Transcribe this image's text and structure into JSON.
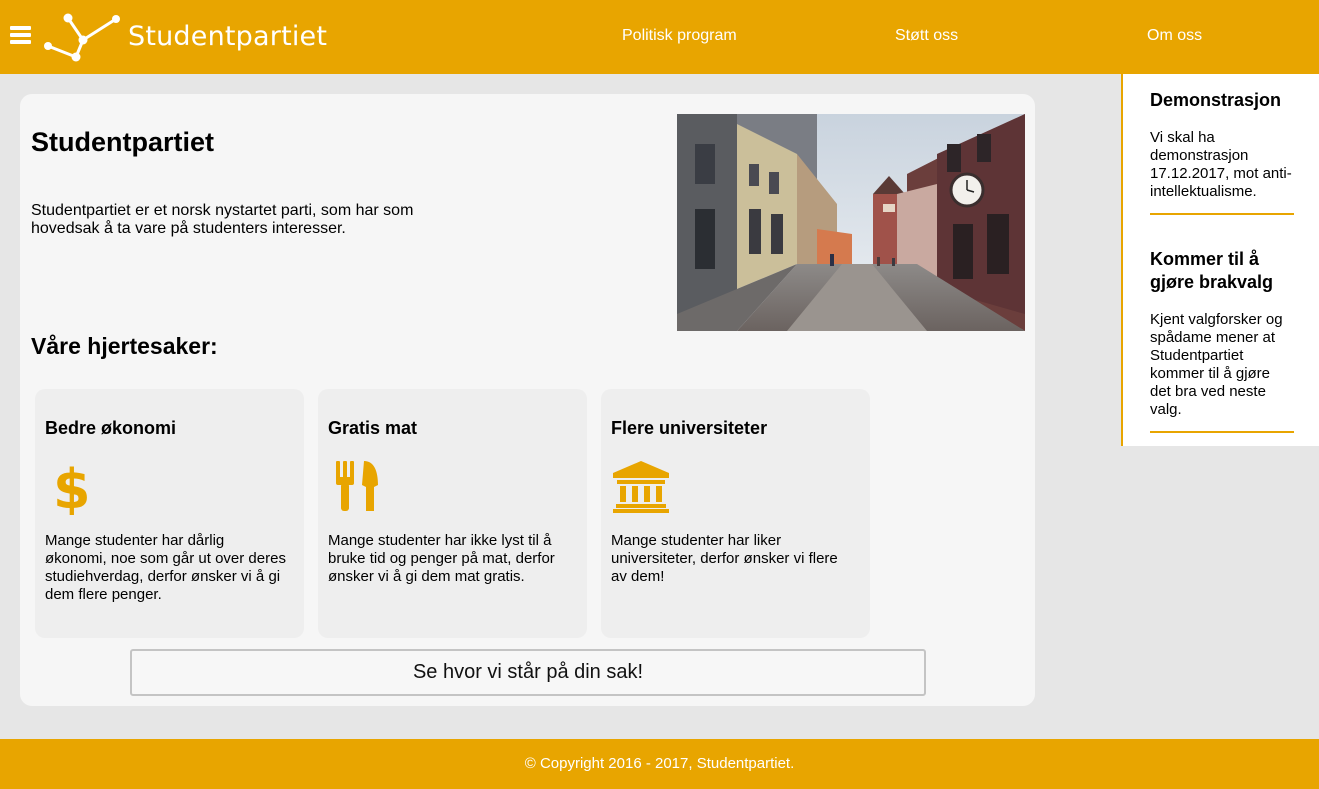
{
  "header": {
    "brand": "Studentpartiet",
    "nav": [
      {
        "label": "Politisk program"
      },
      {
        "label": "Støtt oss"
      },
      {
        "label": "Om oss"
      }
    ]
  },
  "main": {
    "title": "Studentpartiet",
    "intro": "Studentpartiet er et norsk nystartet parti, som har som hovedsak å ta vare på studenters interesser.",
    "section_title": "Våre hjertesaker:",
    "cards": [
      {
        "title": "Bedre økonomi",
        "icon": "dollar-icon",
        "text": "Mange studenter har dårlig økonomi, noe som går ut over deres studiehverdag, derfor ønsker vi å gi dem flere penger."
      },
      {
        "title": "Gratis mat",
        "icon": "cutlery-icon",
        "text": "Mange studenter har ikke lyst til å bruke tid og penger på mat, derfor ønsker vi å gi dem mat gratis."
      },
      {
        "title": "Flere universiteter",
        "icon": "university-icon",
        "text": "Mange studenter har liker universiteter, derfor ønsker vi flere av dem!"
      }
    ],
    "cta_label": "Se hvor vi står på din sak!"
  },
  "side": {
    "news": [
      {
        "title": "Demonstrasjon",
        "text": "Vi skal ha demonstrasjon 17.12.2017, mot anti-intellektualisme."
      },
      {
        "title": "Kommer til å gjøre brakvalg",
        "text": "Kjent valgforsker og spådame mener at Studentpartiet kommer til å gjøre det bra ved neste valg."
      }
    ]
  },
  "footer": {
    "copyright": "© Copyright 2016 - 2017, Studentpartiet."
  },
  "colors": {
    "accent": "#e8a500",
    "panel": "#f6f6f6",
    "card": "#eeeeee",
    "background": "#e6e6e6"
  }
}
